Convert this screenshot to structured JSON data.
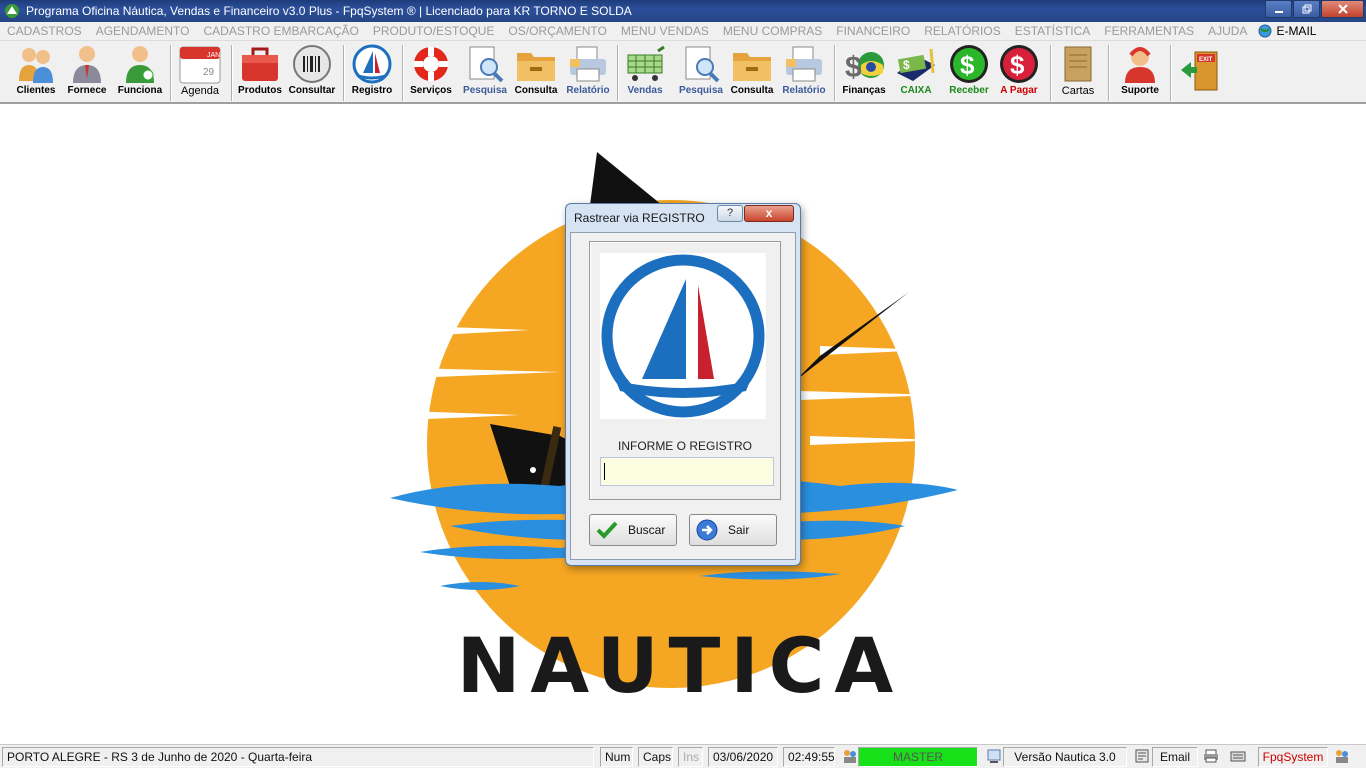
{
  "window": {
    "title": "Programa Oficina Náutica, Vendas e Financeiro v3.0 Plus - FpqSystem ® | Licenciado para  KR TORNO E SOLDA"
  },
  "menu": {
    "items": [
      "CADASTROS",
      "AGENDAMENTO",
      "CADASTRO EMBARCAÇÃO",
      "PRODUTO/ESTOQUE",
      "OS/ORÇAMENTO",
      "MENU VENDAS",
      "MENU COMPRAS",
      "FINANCEIRO",
      "RELATÓRIOS",
      "ESTATÍSTICA",
      "FERRAMENTAS",
      "AJUDA"
    ],
    "email": "E-MAIL"
  },
  "toolbar": {
    "clientes": "Clientes",
    "fornece": "Fornece",
    "funciona": "Funciona",
    "agenda": "Agenda",
    "produtos": "Produtos",
    "consultar": "Consultar",
    "registro": "Registro",
    "servicos": "Serviços",
    "pesquisa1": "Pesquisa",
    "consulta1": "Consulta",
    "relatorio1": "Relatório",
    "vendas": "Vendas",
    "pesquisa2": "Pesquisa",
    "consulta2": "Consulta",
    "relatorio2": "Relatório",
    "financas": "Finanças",
    "caixa": "CAIXA",
    "receber": "Receber",
    "apagar": "A Pagar",
    "cartas": "Cartas",
    "suporte": "Suporte",
    "agenda_month": "JAN",
    "agenda_day": "29",
    "exit_text": "EXIT"
  },
  "background": {
    "brand": "NAUTICA"
  },
  "dialog": {
    "title": "Rastrear via REGISTRO",
    "help": "?",
    "close": "x",
    "prompt": "INFORME O REGISTRO",
    "input_value": "",
    "buscar": "Buscar",
    "sair": "Sair"
  },
  "status": {
    "location": "PORTO ALEGRE - RS   3 de Junho de 2020 - Quarta-feira",
    "num": "Num",
    "caps": "Caps",
    "ins": "Ins",
    "date": "03/06/2020",
    "time": "02:49:55",
    "user": "MASTER",
    "version": "Versão Nautica 3.0",
    "email": "Email",
    "brand": "FpqSystem"
  },
  "colors": {
    "sun": "#f5a623",
    "water": "#2b8fe0",
    "sail_blue": "#1c6fbf",
    "sail_red": "#c8202e",
    "master_bar": "#19e119"
  }
}
